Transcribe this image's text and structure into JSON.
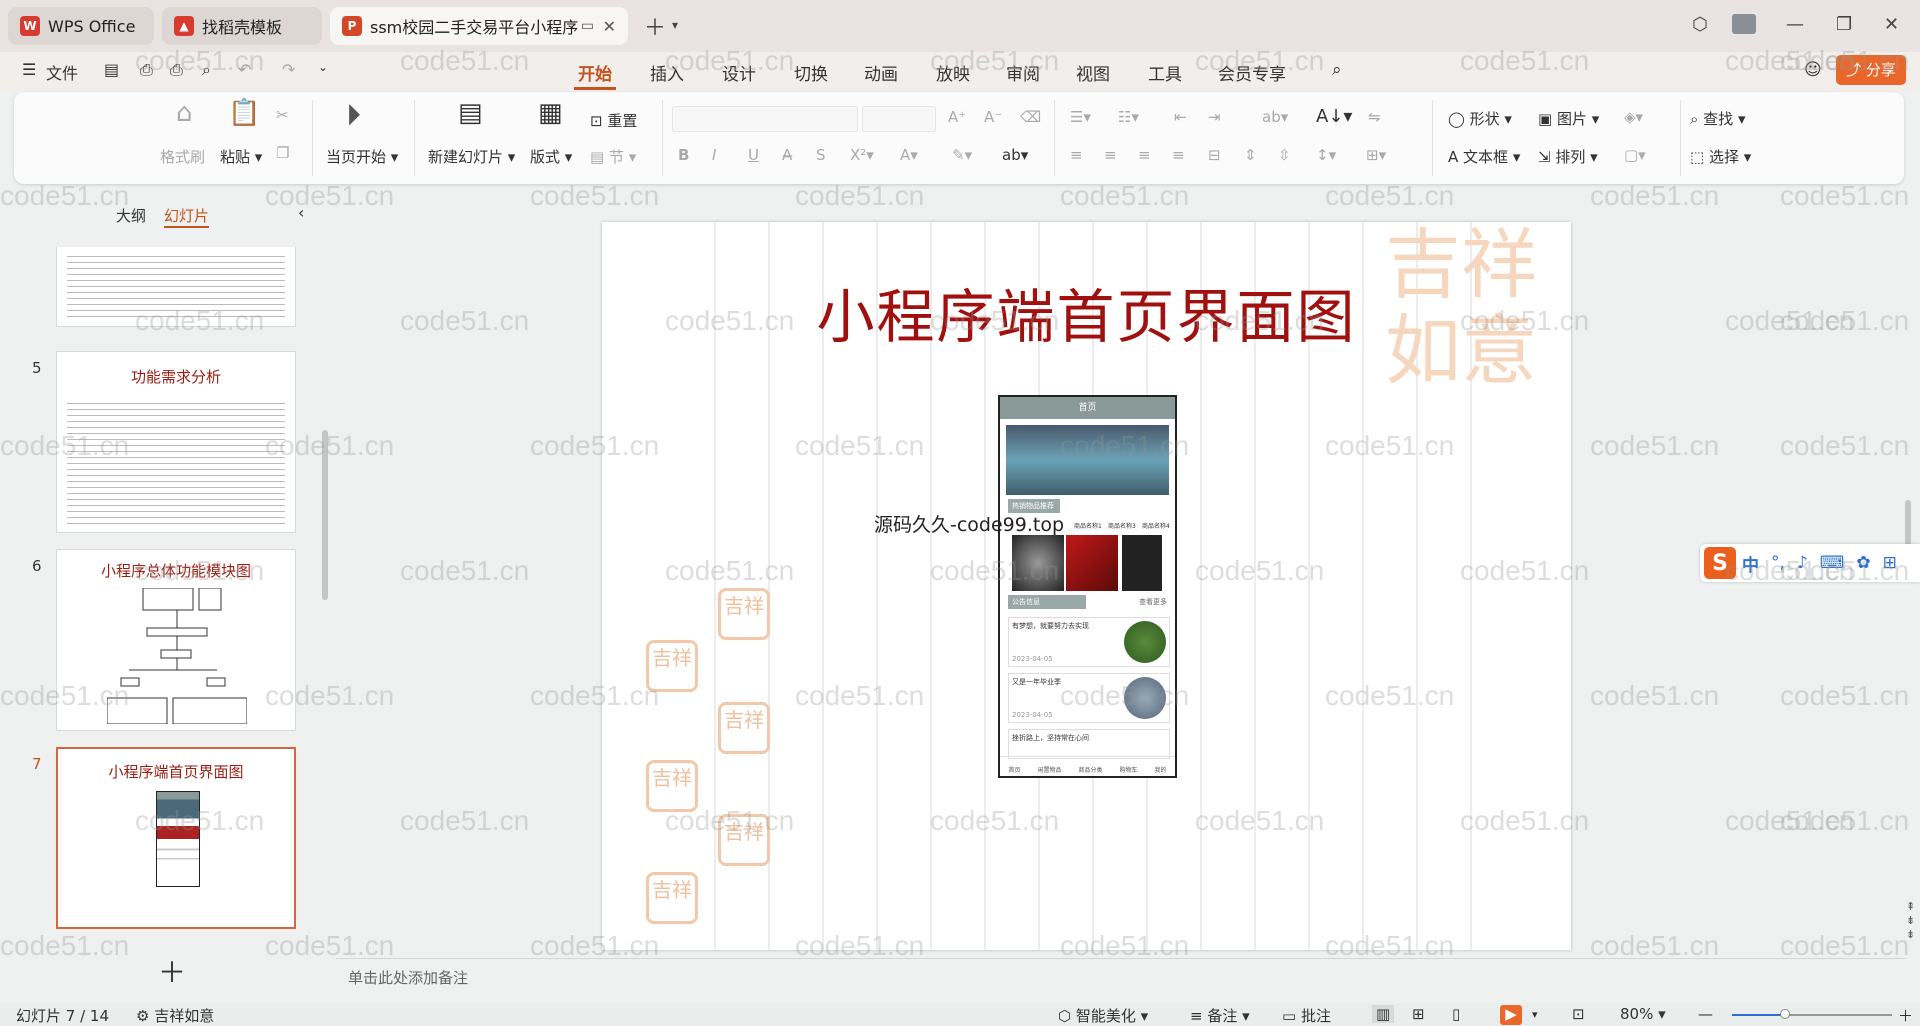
{
  "titlebar": {
    "tabs": [
      {
        "label": "WPS Office"
      },
      {
        "label": "找稻壳模板"
      },
      {
        "label": "ssm校园二手交易平台小程序"
      }
    ]
  },
  "menu": {
    "file_label": "文件",
    "tabs": [
      "开始",
      "插入",
      "设计",
      "切换",
      "动画",
      "放映",
      "审阅",
      "视图",
      "工具",
      "会员专享"
    ],
    "selected_tab": "开始",
    "share_label": "分享"
  },
  "ribbon": {
    "format_painter": "格式刷",
    "paste": "粘贴",
    "play_from_current": "当页开始",
    "new_slide": "新建幻灯片",
    "layout": "版式",
    "reset": "重置",
    "section": "节",
    "shape": "形状",
    "picture": "图片",
    "textbox": "文本框",
    "arrange": "排列",
    "find": "查找",
    "select": "选择"
  },
  "left_pane": {
    "outline_tab": "大纲",
    "slides_tab": "幻灯片",
    "slides": [
      {
        "num": "5",
        "title": "功能需求分析"
      },
      {
        "num": "6",
        "title": "小程序总体功能模块图"
      },
      {
        "num": "7",
        "title": "小程序端首页界面图"
      }
    ]
  },
  "slide": {
    "title": "小程序端首页界面图",
    "overlay_text": "源码久久-code99.top",
    "phone": {
      "header": "首页",
      "section1": "热销物品推荐",
      "product_labels": [
        "商品名称1",
        "商品名称3",
        "商品名称4"
      ],
      "section2": "公告信息",
      "more": "查看更多",
      "news": [
        {
          "title": "有梦想，就要努力去实现",
          "date": "2023-04-05"
        },
        {
          "title": "又是一年毕业季",
          "date": "2023-04-05"
        },
        {
          "title": "挫折路上，坚持常在心间",
          "date": ""
        }
      ],
      "nav": [
        "首页",
        "闲置物品",
        "商品分类",
        "购物车",
        "我的"
      ]
    }
  },
  "notes": {
    "placeholder": "单击此处添加备注"
  },
  "status": {
    "slide_count": "幻灯片 7 / 14",
    "theme": "吉祥如意",
    "smart": "智能美化",
    "notes": "备注",
    "comments": "批注",
    "zoom": "80%"
  },
  "watermark": "code51.cn",
  "ime": {
    "mode": "中"
  }
}
